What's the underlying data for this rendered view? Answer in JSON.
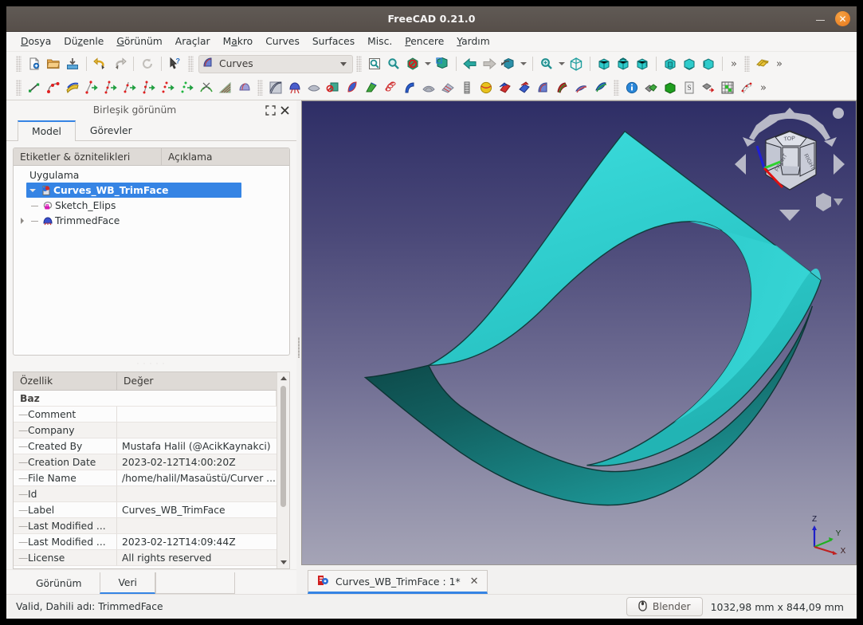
{
  "window": {
    "title": "FreeCAD 0.21.0",
    "minimize_label": "–",
    "close_label": "✕"
  },
  "menubar": {
    "items": [
      {
        "label": "Dosya",
        "mnemonic": "D"
      },
      {
        "label": "Düzenle",
        "mnemonic": "z"
      },
      {
        "label": "Görünüm",
        "mnemonic": "G"
      },
      {
        "label": "Araçlar",
        "mnemonic": ""
      },
      {
        "label": "Makro",
        "mnemonic": "a"
      },
      {
        "label": "Curves",
        "mnemonic": ""
      },
      {
        "label": "Surfaces",
        "mnemonic": ""
      },
      {
        "label": "Misc.",
        "mnemonic": ""
      },
      {
        "label": "Pencere",
        "mnemonic": "P"
      },
      {
        "label": "Yardım",
        "mnemonic": "Y"
      }
    ]
  },
  "toolbar1": {
    "workbench_selected": "Curves",
    "overflow_label": "»",
    "icons": [
      "new-document-icon",
      "open-folder-icon",
      "save-icon",
      "undo-icon",
      "redo-icon",
      "refresh-icon",
      "whats-this-icon",
      "workbench-curves-icon",
      "fit-all-icon",
      "zoom-icon",
      "no-selection-icon",
      "bounding-box-icon",
      "back-arrow-icon",
      "forward-arrow-icon",
      "draw-style-icon",
      "zoom-fit-selection-icon",
      "isometric-view-icon",
      "front-view-icon",
      "top-view-icon",
      "right-view-icon",
      "rear-view-icon",
      "bottom-view-icon",
      "left-view-icon",
      "measure-icon"
    ]
  },
  "toolbar2": {
    "overflow_label": "»",
    "icons": [
      "line-icon",
      "bspline-icon",
      "curves-extend-icon",
      "join-curve-icon",
      "discretize-icon",
      "approximate-icon",
      "interpolate-icon",
      "parametric-blend-icon",
      "point-on-curve-icon",
      "curve-on-surface-icon",
      "gordon-surface-icon",
      "isocurve-icon",
      "hair-comb-icon",
      "zebra-stripes-icon",
      "blend-surface-icon",
      "trim-face-icon",
      "sweep2rails-icon",
      "profile-support-icon",
      "pipeshell-icon",
      "sweep-icon",
      "flatten-face-icon",
      "surface-analysis-icon",
      "segment-surface-icon",
      "sphere-map-icon",
      "mixed-curve-icon",
      "solid-from-shell-icon",
      "curve-wb-icon",
      "blend-curve-icon",
      "paste-shape-icon",
      "comp-filter-icon",
      "info-icon",
      "compound-icon",
      "solid-icon",
      "sketch-icon",
      "extract-geometry-icon",
      "grid-icon",
      "sketch-on-surface-icon"
    ]
  },
  "combo_view": {
    "title": "Birleşik görünüm",
    "undock_icon": "undock-icon",
    "close_icon": "close-icon",
    "tabs": [
      {
        "label": "Model",
        "active": true
      },
      {
        "label": "Görevler",
        "active": false
      }
    ],
    "tree_columns": [
      "Etiketler & öznitelikleri",
      "Açıklama"
    ],
    "tree": [
      {
        "label": "Uygulama",
        "depth": 0,
        "twisty": "none",
        "icon": "none",
        "selected": false
      },
      {
        "label": "Curves_WB_TrimFace",
        "depth": 1,
        "twisty": "down",
        "icon": "document-icon",
        "selected": true
      },
      {
        "label": "Sketch_Elips",
        "depth": 2,
        "twisty": "none",
        "icon": "sketch-elips-icon",
        "selected": false
      },
      {
        "label": "TrimmedFace",
        "depth": 2,
        "twisty": "right",
        "icon": "trimmed-face-icon",
        "selected": false
      }
    ]
  },
  "properties": {
    "columns": [
      "Özellik",
      "Değer"
    ],
    "rows": [
      {
        "group": true,
        "key": "Baz",
        "value": ""
      },
      {
        "group": false,
        "key": "Comment",
        "value": ""
      },
      {
        "group": false,
        "key": "Company",
        "value": ""
      },
      {
        "group": false,
        "key": "Created By",
        "value": "Mustafa Halil (@AcikKaynakci)"
      },
      {
        "group": false,
        "key": "Creation Date",
        "value": "2023-02-12T14:00:20Z"
      },
      {
        "group": false,
        "key": "File Name",
        "value": "/home/halil/Masaüstü/Curver ..."
      },
      {
        "group": false,
        "key": "Id",
        "value": ""
      },
      {
        "group": false,
        "key": "Label",
        "value": "Curves_WB_TrimFace"
      },
      {
        "group": false,
        "key": "Last Modified ...",
        "value": ""
      },
      {
        "group": false,
        "key": "Last Modified ...",
        "value": "2023-02-12T14:09:44Z"
      },
      {
        "group": false,
        "key": "License",
        "value": "All rights reserved"
      }
    ],
    "bottom_tabs": [
      {
        "label": "Görünüm",
        "active": false
      },
      {
        "label": "Veri",
        "active": true
      }
    ]
  },
  "viewport": {
    "document_tab": {
      "label": "Curves_WB_TrimFace : 1*",
      "close_label": "✕",
      "icon": "freecad-doc-icon"
    },
    "navigation_cube": {
      "top_face": "TOP",
      "front_face": "FRONT",
      "right_face": "RIGHT"
    },
    "axis_labels": {
      "x": "X",
      "y": "Y",
      "z": "Z"
    },
    "colors": {
      "bg_top": "#2e2e66",
      "bg_bottom": "#a5a4b6",
      "surface_light": "#2ad2d2",
      "surface_dark": "#0c4a4a"
    }
  },
  "statusbar": {
    "message": "Valid, Dahili adı: TrimmedFace",
    "nav_style": "Blender",
    "nav_icon": "mouse-icon",
    "dimensions": "1032,98 mm x 844,09 mm"
  }
}
